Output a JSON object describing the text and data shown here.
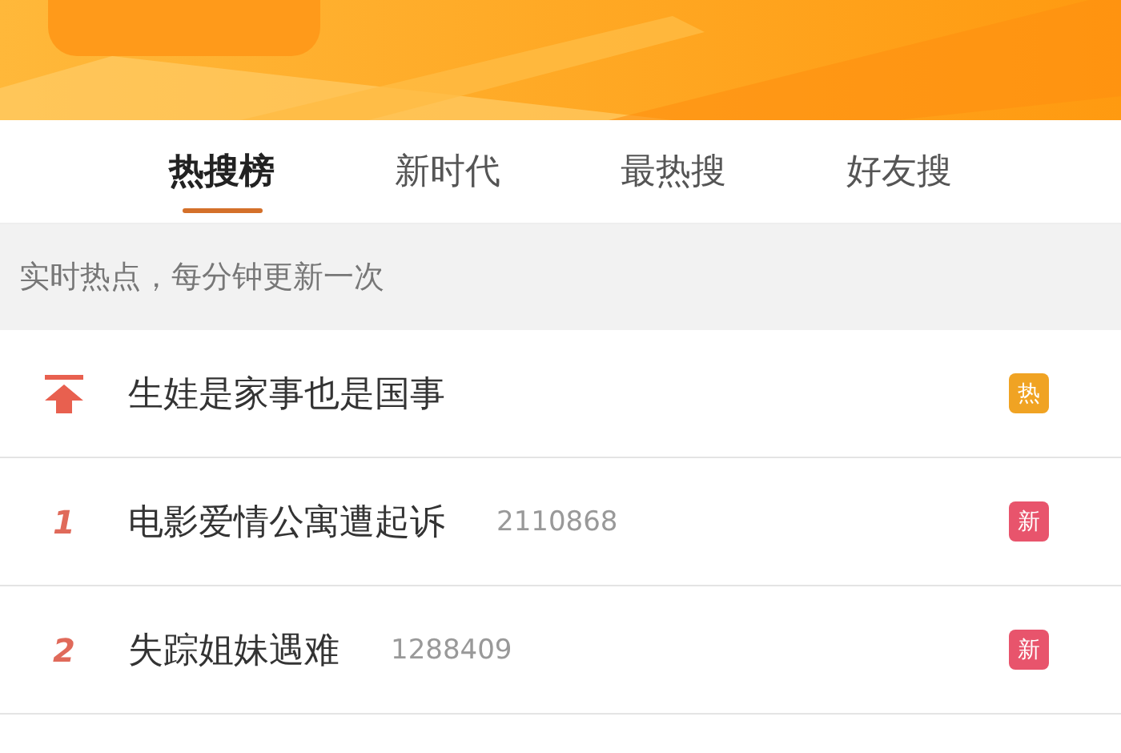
{
  "tabs": [
    {
      "label": "热搜榜",
      "selected": true
    },
    {
      "label": "新时代",
      "selected": false
    },
    {
      "label": "最热搜",
      "selected": false
    },
    {
      "label": "好友搜",
      "selected": false
    }
  ],
  "notice": "实时热点，每分钟更新一次",
  "rows": [
    {
      "kind": "pinned",
      "title": "生娃是家事也是国事",
      "badge": {
        "label": "热",
        "color": "#f0a323"
      }
    },
    {
      "kind": "ranked",
      "rank": "1",
      "title": "电影爱情公寓遭起诉",
      "count": "2110868",
      "badge": {
        "label": "新",
        "color": "#e8546c"
      }
    },
    {
      "kind": "ranked",
      "rank": "2",
      "title": "失踪姐妹遇难",
      "count": "1288409",
      "badge": {
        "label": "新",
        "color": "#e8546c"
      }
    }
  ]
}
